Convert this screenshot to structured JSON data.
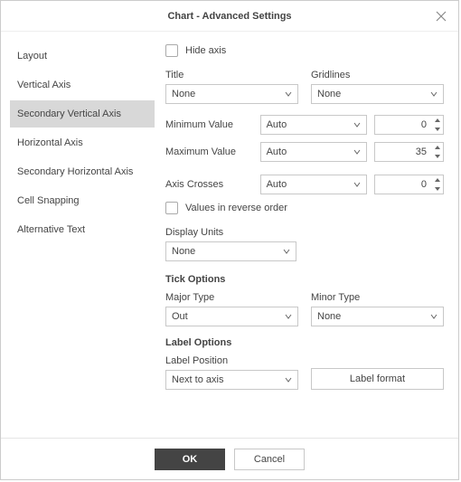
{
  "title": "Chart - Advanced Settings",
  "sidebar": {
    "items": [
      {
        "label": "Layout",
        "selected": false
      },
      {
        "label": "Vertical Axis",
        "selected": false
      },
      {
        "label": "Secondary Vertical Axis",
        "selected": true
      },
      {
        "label": "Horizontal Axis",
        "selected": false
      },
      {
        "label": "Secondary Horizontal Axis",
        "selected": false
      },
      {
        "label": "Cell Snapping",
        "selected": false
      },
      {
        "label": "Alternative Text",
        "selected": false
      }
    ]
  },
  "content": {
    "hide_axis_label": "Hide axis",
    "title_label": "Title",
    "title_value": "None",
    "gridlines_label": "Gridlines",
    "gridlines_value": "None",
    "min_label": "Minimum Value",
    "min_mode": "Auto",
    "min_value": "0",
    "max_label": "Maximum Value",
    "max_mode": "Auto",
    "max_value": "35",
    "crosses_label": "Axis Crosses",
    "crosses_mode": "Auto",
    "crosses_value": "0",
    "reverse_label": "Values in reverse order",
    "display_units_label": "Display Units",
    "display_units_value": "None",
    "tick_section": "Tick Options",
    "major_type_label": "Major Type",
    "major_type_value": "Out",
    "minor_type_label": "Minor Type",
    "minor_type_value": "None",
    "label_section": "Label Options",
    "label_position_label": "Label Position",
    "label_position_value": "Next to axis",
    "label_format_btn": "Label format"
  },
  "footer": {
    "ok": "OK",
    "cancel": "Cancel"
  }
}
